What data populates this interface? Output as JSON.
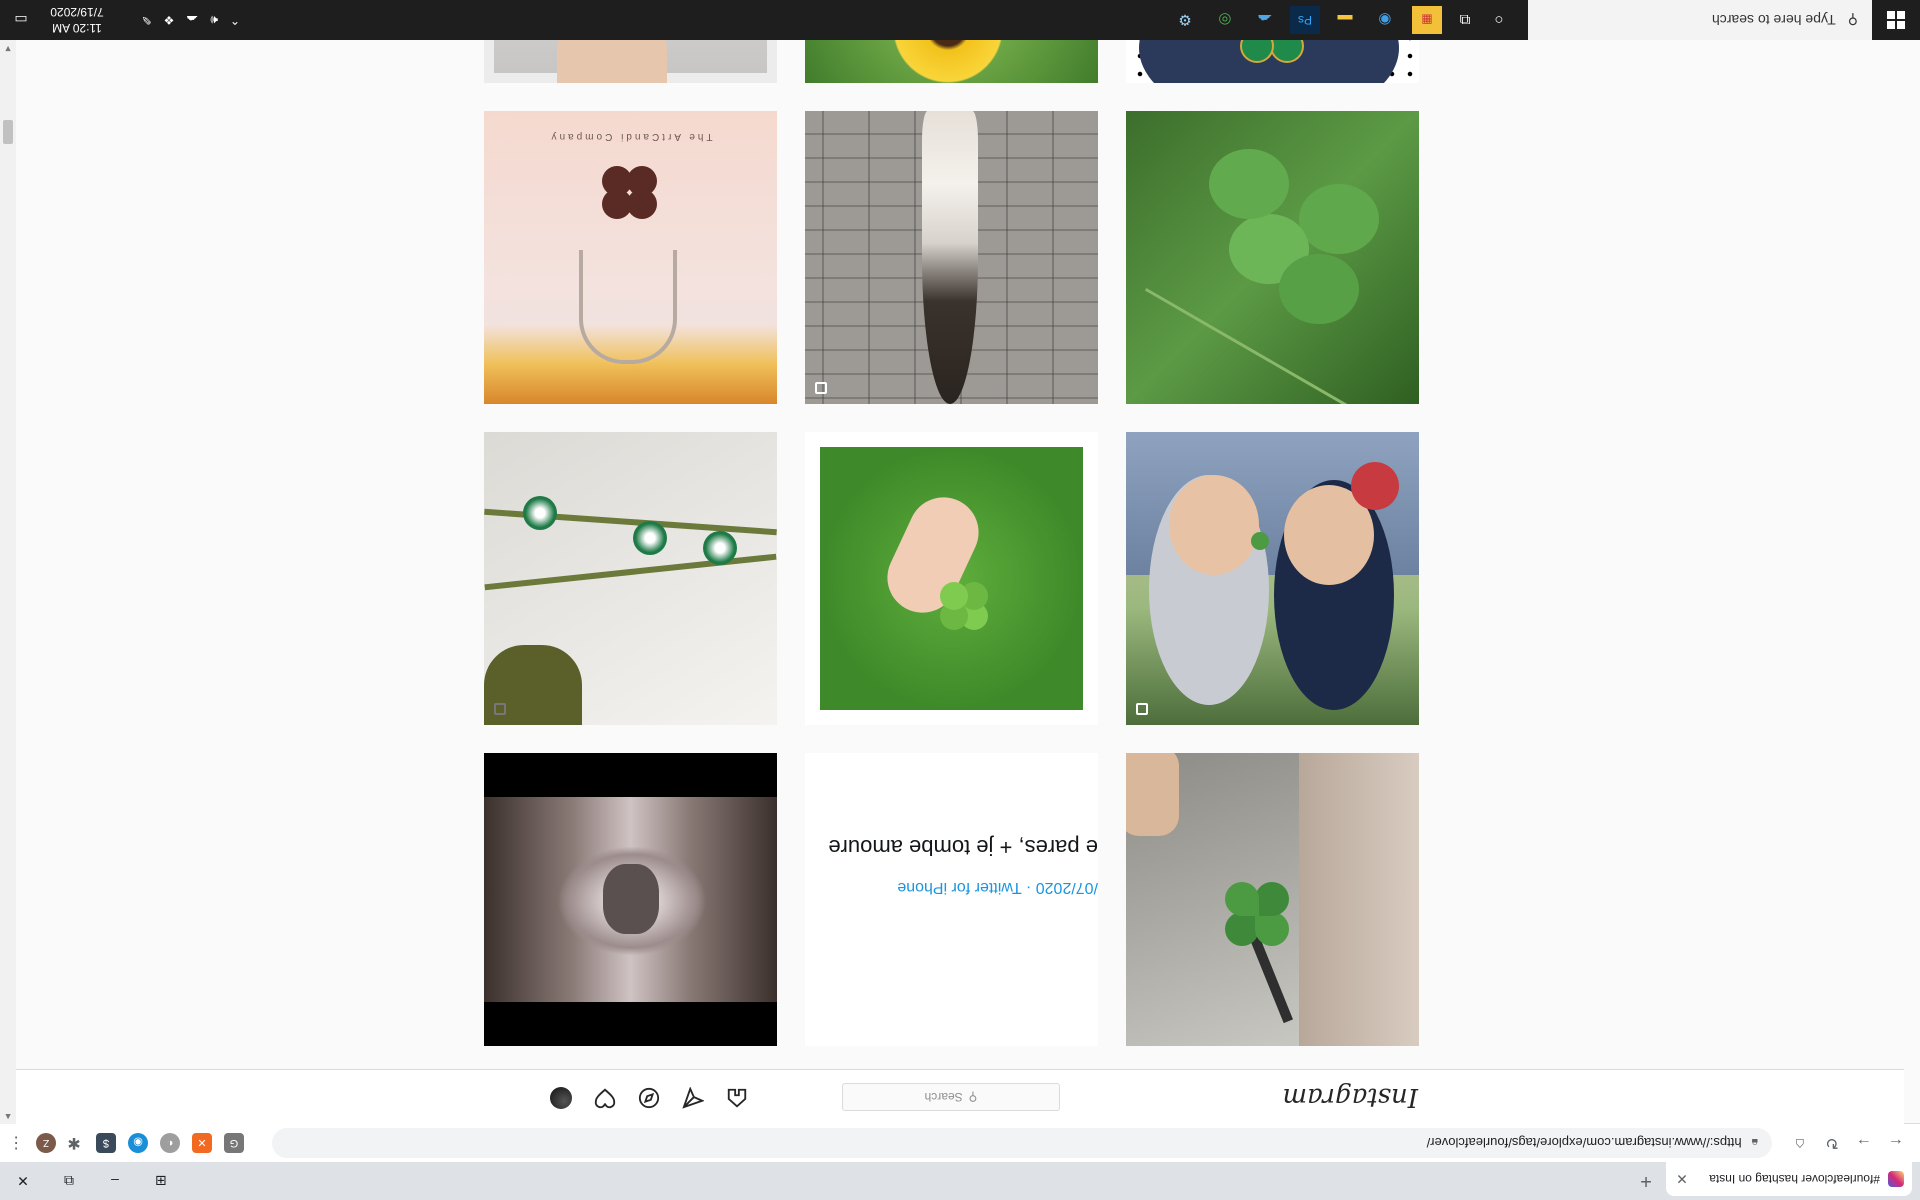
{
  "browser": {
    "tab_title": "#fourleafclover hashtag on Insta",
    "url": "https://www.instagram.com/explore/tags/fourleafclover/"
  },
  "instagram": {
    "logo": "Instagram",
    "search_placeholder": "Search"
  },
  "grid": {
    "tiles": [
      {
        "name": "clover-held-by-hand-with-dog",
        "caption": ""
      },
      {
        "name": "tweet-screenshot-post",
        "tweet_text": "e pares, + je tombe amoure",
        "tweet_meta": "/07/2020 · Twitter for iPhone"
      },
      {
        "name": "ornate-wolf-artwork",
        "caption": ""
      },
      {
        "name": "two-kids-holding-clover",
        "caption": ""
      },
      {
        "name": "hand-holding-four-leaf-clover",
        "caption": ""
      },
      {
        "name": "green-clover-beads-jewelry",
        "caption": ""
      },
      {
        "name": "clover-plant-in-grass",
        "caption": ""
      },
      {
        "name": "feather-on-brick",
        "caption": ""
      },
      {
        "name": "clover-charm-necklace",
        "brand_text": "The ArtCandi Company"
      },
      {
        "name": "clover-pin-on-denim",
        "caption": ""
      },
      {
        "name": "sunflower",
        "caption": ""
      },
      {
        "name": "baby-hand-on-blanket",
        "caption": ""
      }
    ]
  },
  "taskbar": {
    "search_placeholder": "Type here to search",
    "time": "11:20 AM",
    "date": "7/19/2020"
  },
  "colors": {
    "instagram_bg": "#fafafa",
    "taskbar_bg": "#1e1e1e",
    "tab_strip_bg": "#dee1e6"
  }
}
